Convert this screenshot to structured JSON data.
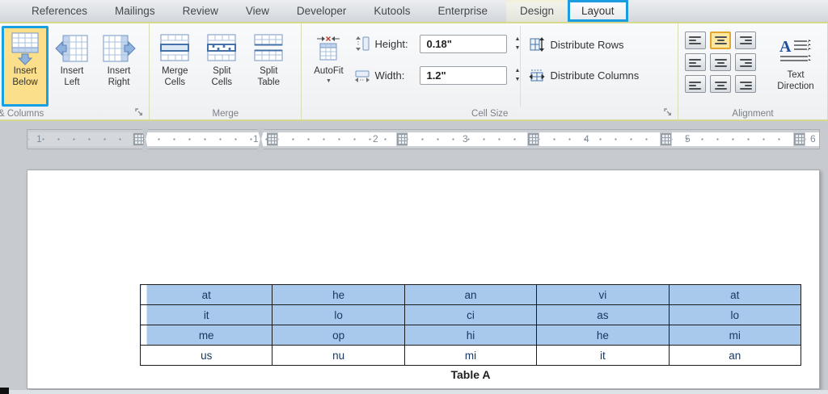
{
  "tabs": {
    "items": [
      {
        "label": "References"
      },
      {
        "label": "Mailings"
      },
      {
        "label": "Review"
      },
      {
        "label": "View"
      },
      {
        "label": "Developer"
      },
      {
        "label": "Kutools"
      },
      {
        "label": "Enterprise"
      },
      {
        "label": "Design"
      },
      {
        "label": "Layout"
      }
    ],
    "active_tab": "Layout"
  },
  "ribbon": {
    "groups": {
      "rows_columns": {
        "label": "& Columns",
        "buttons": [
          {
            "label": "Insert\nBelow",
            "highlighted": true
          },
          {
            "label": "Insert\nLeft",
            "highlighted": false
          },
          {
            "label": "Insert\nRight",
            "highlighted": false
          }
        ]
      },
      "merge": {
        "label": "Merge",
        "buttons": [
          {
            "label": "Merge\nCells"
          },
          {
            "label": "Split\nCells"
          },
          {
            "label": "Split\nTable"
          }
        ]
      },
      "cell_size": {
        "label": "Cell Size",
        "autofit_label": "AutoFit",
        "height_label": "Height:",
        "height_value": "0.18\"",
        "width_label": "Width:",
        "width_value": "1.2\"",
        "distribute_rows_label": "Distribute Rows",
        "distribute_columns_label": "Distribute Columns"
      },
      "alignment": {
        "label": "Alignment",
        "text_direction_label": "Text\nDirection",
        "active_alignment": "align-center-top"
      }
    }
  },
  "ruler": {
    "margin_number": "1",
    "numbers": [
      "1",
      "2",
      "3",
      "4",
      "5",
      "6"
    ]
  },
  "document": {
    "table": {
      "rows": [
        [
          "at",
          "he",
          "an",
          "vi",
          "at"
        ],
        [
          "it",
          "lo",
          "ci",
          "as",
          "lo"
        ],
        [
          "me",
          "op",
          "hi",
          "he",
          "mi"
        ],
        [
          "us",
          "nu",
          "mi",
          "it",
          "an"
        ]
      ],
      "selected_row_indices": [
        0,
        1,
        2
      ]
    },
    "caption": "Table A"
  },
  "colors": {
    "annotation_blue": "#1b9ce0",
    "button_highlight_fill": "#fbdf8b",
    "alignment_active_border": "#e3a72f",
    "selection_blue": "#a9c9ec",
    "contextual_accent_line": "#d6d98b",
    "table_text": "#17365d"
  },
  "icons": [
    "insert-below-icon",
    "insert-left-icon",
    "insert-right-icon",
    "merge-cells-icon",
    "split-cells-icon",
    "split-table-icon",
    "autofit-icon",
    "autofit-dropdown-icon",
    "row-height-icon",
    "column-width-icon",
    "spinner-up-icon",
    "spinner-down-icon",
    "distribute-rows-icon",
    "distribute-columns-icon",
    "text-direction-icon",
    "dialog-launcher-icon",
    "ruler-table-marker-icon",
    "ruler-column-handle-icon"
  ]
}
